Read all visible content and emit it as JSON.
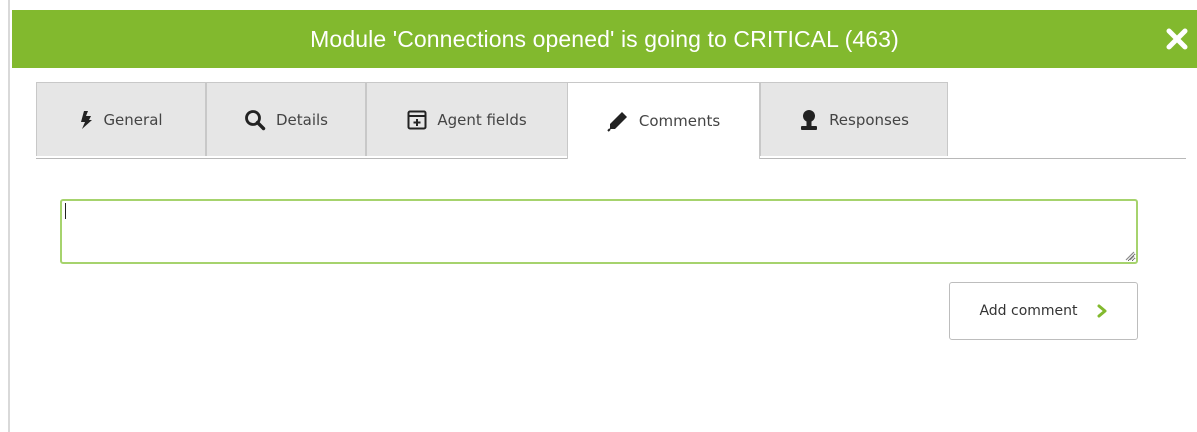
{
  "dialog": {
    "title": "Module 'Connections opened' is going to CRITICAL (463)",
    "close_icon": "close-icon",
    "accent_color": "#82b92e"
  },
  "tabs": [
    {
      "label": "General",
      "icon": "general-icon",
      "active": false
    },
    {
      "label": "Details",
      "icon": "search-icon",
      "active": false
    },
    {
      "label": "Agent fields",
      "icon": "agent-fields-icon",
      "active": false
    },
    {
      "label": "Comments",
      "icon": "pencil-icon",
      "active": true
    },
    {
      "label": "Responses",
      "icon": "responses-icon",
      "active": false
    }
  ],
  "comment": {
    "value": "",
    "border_color": "#a6d36d"
  },
  "actions": {
    "add_comment_label": "Add comment",
    "add_comment_icon": "chevron-right-icon"
  }
}
